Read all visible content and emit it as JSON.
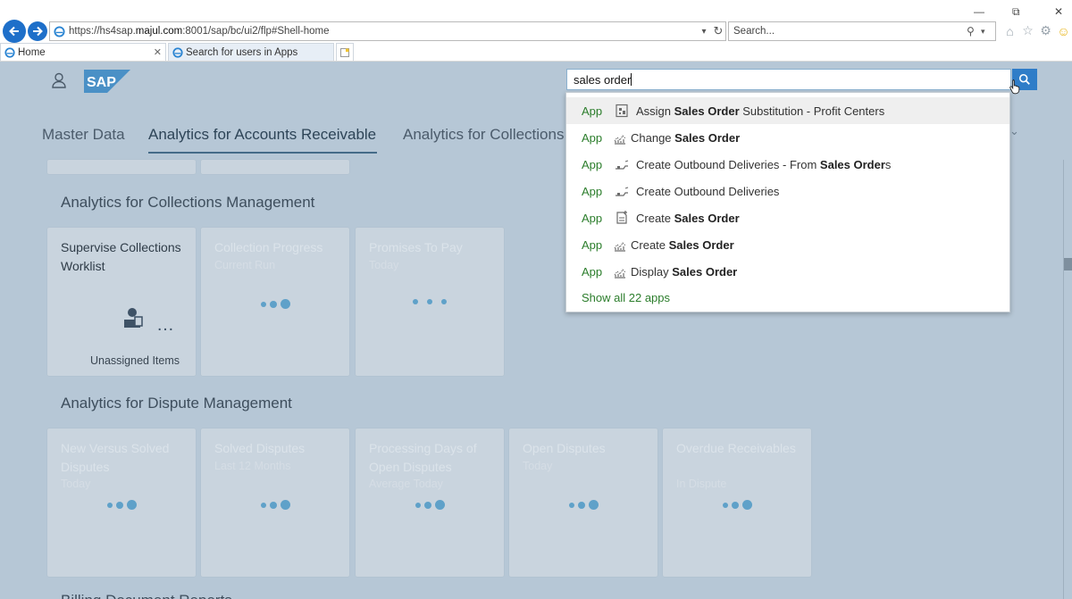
{
  "browser": {
    "url_prefix": "https://hs4sap.",
    "url_domain": "majul.com",
    "url_rest": ":8001/sap/bc/ui2/flp#Shell-home",
    "search_placeholder": "Search...",
    "tabs": [
      {
        "label": "Home"
      },
      {
        "label": "Search for users in Apps"
      }
    ]
  },
  "shell": {
    "anchor_items": [
      "Master Data",
      "Analytics for Accounts Receivable",
      "Analytics for Collections"
    ],
    "selected_anchor": "Analytics for Accounts Receivable"
  },
  "sections": [
    {
      "title": "Analytics for Collections Management",
      "tiles": [
        {
          "title": "Supervise Collections Worklist",
          "footer": "Unassigned Items"
        },
        {
          "title": "Collection Progress",
          "subtitle": "Current Run"
        },
        {
          "title": "Promises To Pay",
          "subtitle": "Today"
        }
      ]
    },
    {
      "title": "Analytics for Dispute Management",
      "tiles": [
        {
          "title": "New Versus Solved Disputes",
          "subtitle": "Today"
        },
        {
          "title": "Solved Disputes",
          "subtitle": "Last 12 Months"
        },
        {
          "title": "Processing Days of Open Disputes",
          "subtitle": "Average Today"
        },
        {
          "title": "Open Disputes",
          "subtitle": "Today"
        },
        {
          "title": "Overdue Receivables",
          "subtitle": "In Dispute"
        }
      ]
    },
    {
      "title": "Billing Document Reports"
    }
  ],
  "search": {
    "value": "sales order",
    "suggestions": [
      {
        "type": "App",
        "icon": "substitution-icon",
        "pre": "Assign ",
        "bold": "Sales Order",
        "post": " Substitution - Profit Centers",
        "highlighted": true
      },
      {
        "type": "App",
        "icon": "chart-icon",
        "pre": "Change ",
        "bold": "Sales Order",
        "post": ""
      },
      {
        "type": "App",
        "icon": "delivery-icon",
        "pre": "Create Outbound Deliveries - From ",
        "bold": "Sales Order",
        "post": "s"
      },
      {
        "type": "App",
        "icon": "delivery-icon",
        "pre": "Create Outbound Deliveries",
        "bold": "",
        "post": ""
      },
      {
        "type": "App",
        "icon": "create-document-icon",
        "pre": "Create ",
        "bold": "Sales Order",
        "post": ""
      },
      {
        "type": "App",
        "icon": "chart-icon",
        "pre": "Create ",
        "bold": "Sales Order",
        "post": ""
      },
      {
        "type": "App",
        "icon": "chart-icon",
        "pre": "Display ",
        "bold": "Sales Order",
        "post": ""
      }
    ],
    "show_all": "Show all 22 apps"
  }
}
